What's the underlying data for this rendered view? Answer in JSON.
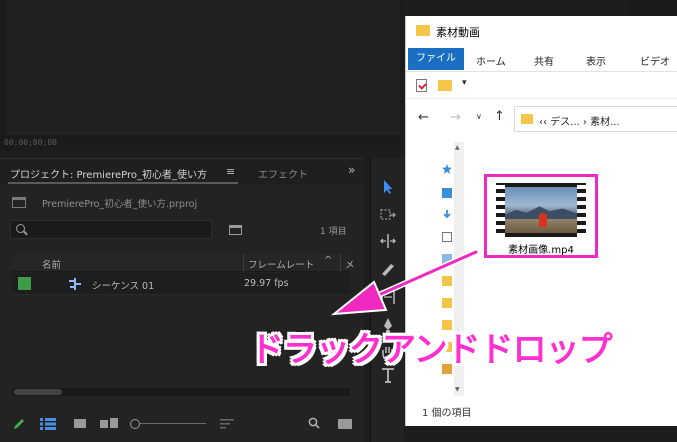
{
  "premiere": {
    "timecode": "00;00;00;00",
    "tabs": {
      "project": "プロジェクト: PremierePro_初心者_使い方",
      "menu_glyph": "≡",
      "effect": "エフェクト",
      "more_glyph": "»"
    },
    "project_file": "PremierePro_初心者_使い方.prproj",
    "item_count": "1 項目",
    "columns": {
      "name": "名前",
      "frame_rate": "フレームレート",
      "sort_glyph": "^",
      "extra": "メ"
    },
    "rows": [
      {
        "name": "シーケンス 01",
        "fps": "29.97 fps",
        "label_color": "#3f9b4a"
      }
    ]
  },
  "explorer": {
    "title": "素材動画",
    "ribbon": {
      "file": "ファイル",
      "home": "ホーム",
      "share": "共有",
      "view": "表示",
      "video": "ビデオ"
    },
    "address": "‹‹  デス...  ›  素材...",
    "file": {
      "name": "素材画像.mp4"
    },
    "status": "1 個の項目"
  },
  "annotation": {
    "text": "ドラックアンドドロップ",
    "color": "#ff2fd0"
  }
}
